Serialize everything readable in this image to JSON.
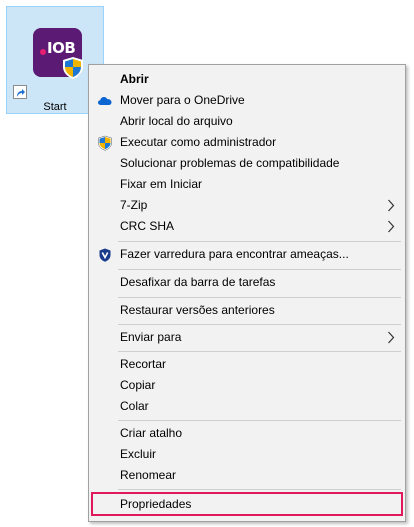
{
  "desktop_icon": {
    "label": "Start",
    "brand_text": "IOB",
    "colors": {
      "tile": "#5b1a73",
      "dot": "#e61f72",
      "selection": "#cde6f7"
    }
  },
  "context_menu": {
    "items": [
      {
        "label": "Abrir",
        "bold": true
      },
      {
        "label": "Mover para o OneDrive",
        "icon": "onedrive-cloud-icon"
      },
      {
        "label": "Abrir local do arquivo"
      },
      {
        "label": "Executar como administrador",
        "icon": "uac-shield-icon"
      },
      {
        "label": "Solucionar problemas de compatibilidade"
      },
      {
        "label": "Fixar em Iniciar"
      },
      {
        "label": "7-Zip",
        "submenu": true
      },
      {
        "label": "CRC SHA",
        "submenu": true
      },
      {
        "label": "Fazer varredura para encontrar ameaças...",
        "icon": "defender-shield-icon"
      },
      {
        "label": "Desafixar da barra de tarefas"
      },
      {
        "label": "Restaurar versões anteriores"
      },
      {
        "label": "Enviar para",
        "submenu": true
      },
      {
        "label": "Recortar"
      },
      {
        "label": "Copiar"
      },
      {
        "label": "Colar"
      },
      {
        "label": "Criar atalho"
      },
      {
        "label": "Excluir"
      },
      {
        "label": "Renomear"
      },
      {
        "label": "Propriedades",
        "highlighted": true
      }
    ],
    "highlight_color": "#e0195c"
  }
}
